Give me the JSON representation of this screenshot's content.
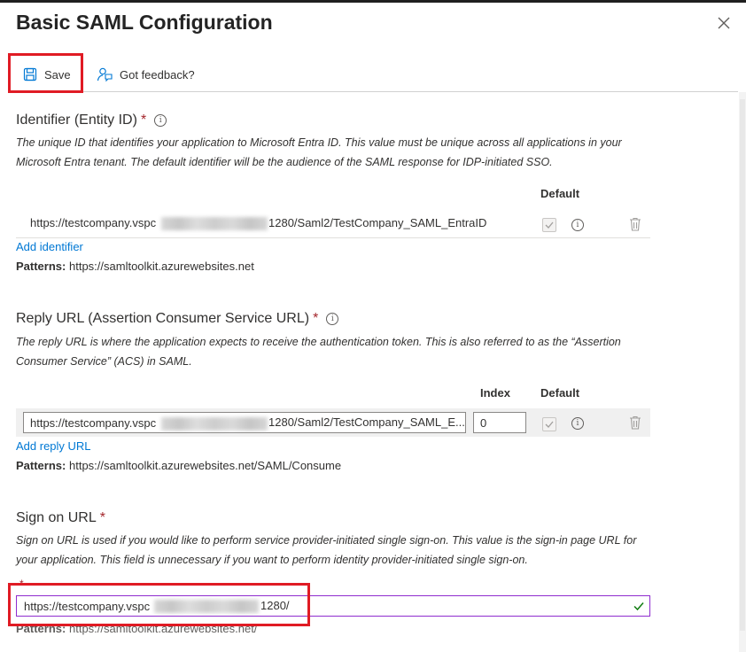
{
  "panel": {
    "title": "Basic SAML Configuration",
    "close_icon": "close-icon"
  },
  "toolbar": {
    "save_label": "Save",
    "save_icon": "save-icon",
    "feedback_label": "Got feedback?",
    "feedback_icon": "feedback-icon"
  },
  "identifier": {
    "title": "Identifier (Entity ID)",
    "required_mark": "*",
    "description": "The unique ID that identifies your application to Microsoft Entra ID. This value must be unique across all applications in your Microsoft Entra tenant. The default identifier will be the audience of the SAML response for IDP-initiated SSO.",
    "column_default": "Default",
    "rows": [
      {
        "url_prefix": "https://testcompany.vspc",
        "url_suffix": "1280/Saml2/TestCompany_SAML_EntraID",
        "default_checked": true
      }
    ],
    "add_link": "Add identifier",
    "patterns_label": "Patterns:",
    "patterns_value": "https://samltoolkit.azurewebsites.net"
  },
  "reply_url": {
    "title": "Reply URL (Assertion Consumer Service URL)",
    "required_mark": "*",
    "description": "The reply URL is where the application expects to receive the authentication token. This is also referred to as the “Assertion Consumer Service” (ACS) in SAML.",
    "column_index": "Index",
    "column_default": "Default",
    "rows": [
      {
        "url_prefix": "https://testcompany.vspc",
        "url_suffix": "1280/Saml2/TestCompany_SAML_E...",
        "index": "0",
        "default_checked": true
      }
    ],
    "add_link": "Add reply URL",
    "patterns_label": "Patterns:",
    "patterns_value": "https://samltoolkit.azurewebsites.net/SAML/Consume"
  },
  "sign_on": {
    "title": "Sign on URL",
    "required_mark": "*",
    "description": "Sign on URL is used if you would like to perform service provider-initiated single sign-on. This value is the sign-in page URL for your application. This field is unnecessary if you want to perform identity provider-initiated single sign-on.",
    "field_required_mark": "*",
    "value_prefix": "https://testcompany.vspc",
    "value_suffix": "1280/",
    "valid_icon": "checkmark-icon",
    "patterns_label": "Patterns:",
    "patterns_value": "https://samltoolkit.azurewebsites.net/"
  },
  "colors": {
    "accent": "#0078d4",
    "required": "#a4262c",
    "highlight": "#e01b24",
    "input_focus": "#8f2ccf",
    "valid": "#107c10"
  }
}
